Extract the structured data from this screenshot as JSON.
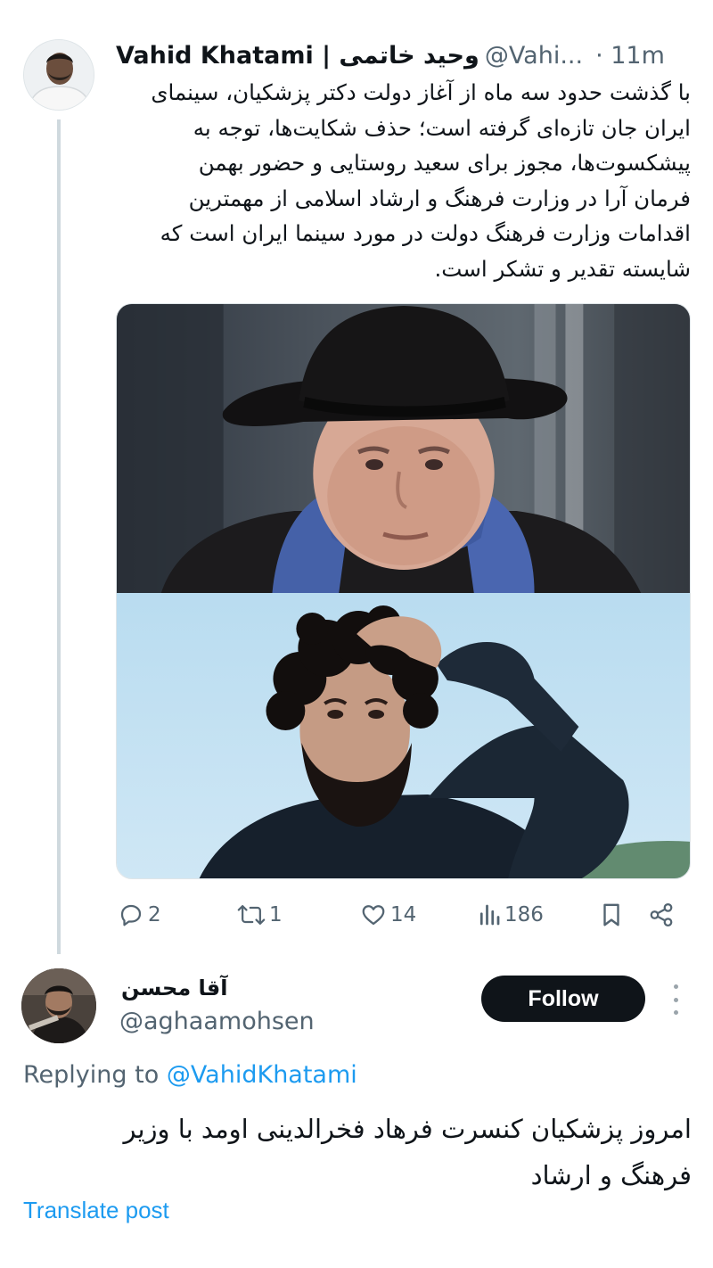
{
  "colors": {
    "text_primary": "#0f1419",
    "text_secondary": "#536471",
    "accent": "#1d9bf0",
    "thread_line": "#cfd9de",
    "follow_button_bg": "#0f1419"
  },
  "tweet": {
    "author": {
      "display_name": "Vahid Khatami | وحید خاتمی",
      "handle": "@Vahi...",
      "time": "· 11m",
      "avatar_icon": "user-avatar"
    },
    "body_lines": [
      "با گذشت حدود سه ماه از آغاز دولت دکتر پزشکیان، سینمای",
      "ایران جان تازه‌ای گرفته است؛ حذف شکایت‌ها، توجه به",
      "پیشکسوت‌ها، مجوز برای سعید روستایی و حضور بهمن",
      "فرمان آرا در وزارت فرهنگ و ارشاد اسلامی از مهمترین",
      "اقدامات وزارت فرهنگ دولت در مورد سینما ایران است که",
      "شایسته تقدیر و تشکر است."
    ],
    "media": [
      {
        "icon": "photo-older-man-black-hat-blue-scarf"
      },
      {
        "icon": "photo-bearded-man-curly-hair"
      }
    ],
    "actions": {
      "replies": "2",
      "reposts": "1",
      "likes": "14",
      "views": "186",
      "icons": [
        "reply-icon",
        "repost-icon",
        "like-icon",
        "views-icon",
        "bookmark-icon",
        "share-icon"
      ]
    }
  },
  "reply": {
    "author": {
      "display_name": "آقا محسن",
      "handle": "@aghaamohsen",
      "avatar_icon": "user-avatar"
    },
    "follow_label": "Follow",
    "replying_prefix": "Replying to",
    "replying_to": "@VahidKhatami",
    "body_lines": [
      "امروز پزشکیان کنسرت فرهاد فخرالدینی اومد با وزیر",
      "فرهنگ و ارشاد"
    ],
    "translate_label": "Translate post"
  }
}
